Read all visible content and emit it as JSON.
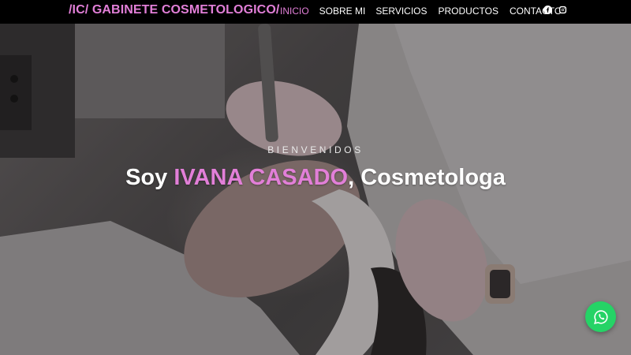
{
  "navbar": {
    "brand": "/IC/ GABINETE COSMETOLOGICO/",
    "links": [
      "INICIO",
      "SOBRE MI",
      "SERVICIOS",
      "PRODUCTOS",
      "CONTACTO"
    ],
    "active_index": 0,
    "social": [
      "facebook-icon",
      "instagram-icon"
    ]
  },
  "hero": {
    "kicker": "BIENVENIDOS",
    "headline_prefix": "Soy ",
    "headline_name": "IVANA CASADO",
    "headline_suffix": ", Cosmetologa"
  },
  "floating": {
    "whatsapp_icon": "whatsapp-icon"
  },
  "colors": {
    "accent": "#e27fd8",
    "navbar_bg": "#000000",
    "whatsapp": "#25d366"
  }
}
